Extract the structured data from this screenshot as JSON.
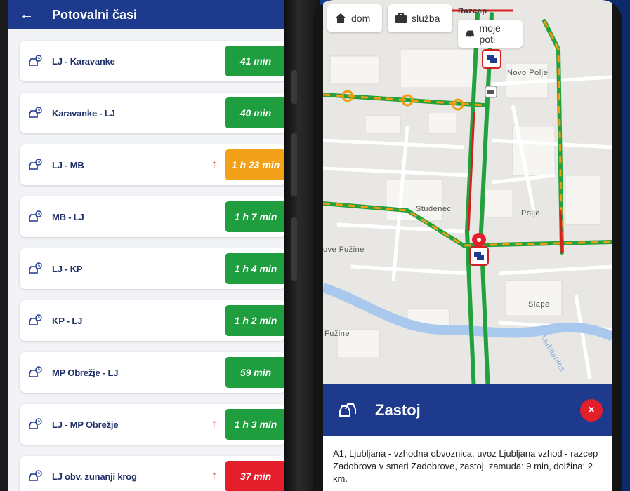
{
  "left_app": {
    "title": "Potovalni časi",
    "routes": [
      {
        "name": "LJ - Karavanke",
        "time": "41 min",
        "status_color": "#1e9e3e",
        "trend": ""
      },
      {
        "name": "Karavanke - LJ",
        "time": "40 min",
        "status_color": "#1e9e3e",
        "trend": ""
      },
      {
        "name": "LJ - MB",
        "time": "1 h 23 min",
        "status_color": "#f4a11a",
        "trend": "↑"
      },
      {
        "name": "MB - LJ",
        "time": "1 h 7 min",
        "status_color": "#1e9e3e",
        "trend": ""
      },
      {
        "name": "LJ - KP",
        "time": "1 h 4 min",
        "status_color": "#1e9e3e",
        "trend": ""
      },
      {
        "name": "KP - LJ",
        "time": "1 h 2 min",
        "status_color": "#1e9e3e",
        "trend": ""
      },
      {
        "name": "MP Obrežje - LJ",
        "time": "59 min",
        "status_color": "#1e9e3e",
        "trend": ""
      },
      {
        "name": "LJ - MP Obrežje",
        "time": "1 h 3 min",
        "status_color": "#1e9e3e",
        "trend": "↑"
      },
      {
        "name": "LJ obv. zunanji krog",
        "time": "37 min",
        "status_color": "#e41e2b",
        "trend": "↑"
      }
    ]
  },
  "map_app": {
    "chips": {
      "home": "dom",
      "work": "služba",
      "my_routes": "moje poti"
    },
    "places": {
      "top_road": "Razcep",
      "novo_polje": "Novo Polje",
      "studenec": "Studenec",
      "polje": "Polje",
      "nove_fuzine": "ove Fužine",
      "slape": "Slape",
      "fuzine": "Fužine",
      "river": "Ljubljanica"
    },
    "incident": {
      "title": "Zastoj",
      "description": "A1, Ljubljana - vzhodna obvoznica, uvoz Ljubljana vzhod - razcep Zadobrova v smeri Zadobrove, zastoj, zamuda: 9 min, dolžina: 2 km.",
      "close_symbol": "×"
    }
  },
  "colors": {
    "brand_blue": "#1e3a8c",
    "ok_green": "#1e9e3e",
    "warn_orange": "#f4a11a",
    "alert_red": "#e41e2b"
  }
}
